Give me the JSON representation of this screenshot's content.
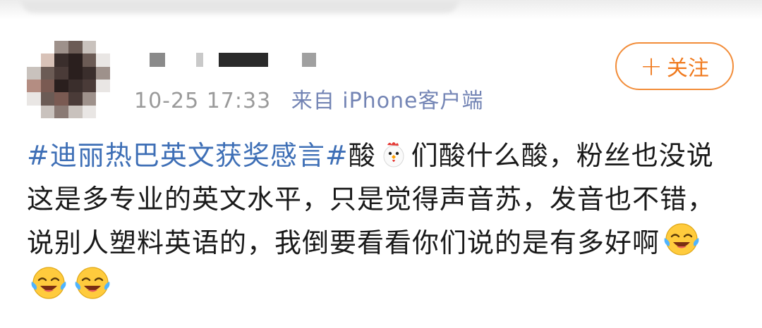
{
  "post": {
    "meta": {
      "time": "10-25 17:33",
      "source": "来自 iPhone客户端"
    },
    "follow_label": "关注",
    "follow_plus": "+",
    "content": {
      "hashtag": "#迪丽热巴英文获奖感言#",
      "text_part1": "酸",
      "text_part2": "们酸什么酸，粉丝也没说这是多专业的英文水平，只是觉得声音苏，发音也不错，说别人塑料英语的，我倒要看看你们说的是有多好啊"
    },
    "emojis": [
      "chicken-icon",
      "laughing-crying-icon",
      "laughing-crying-icon",
      "laughing-crying-icon"
    ]
  },
  "colors": {
    "hashtag": "#3e6fb6",
    "follow": "#f07a1e",
    "meta": "#9a9a9a"
  }
}
